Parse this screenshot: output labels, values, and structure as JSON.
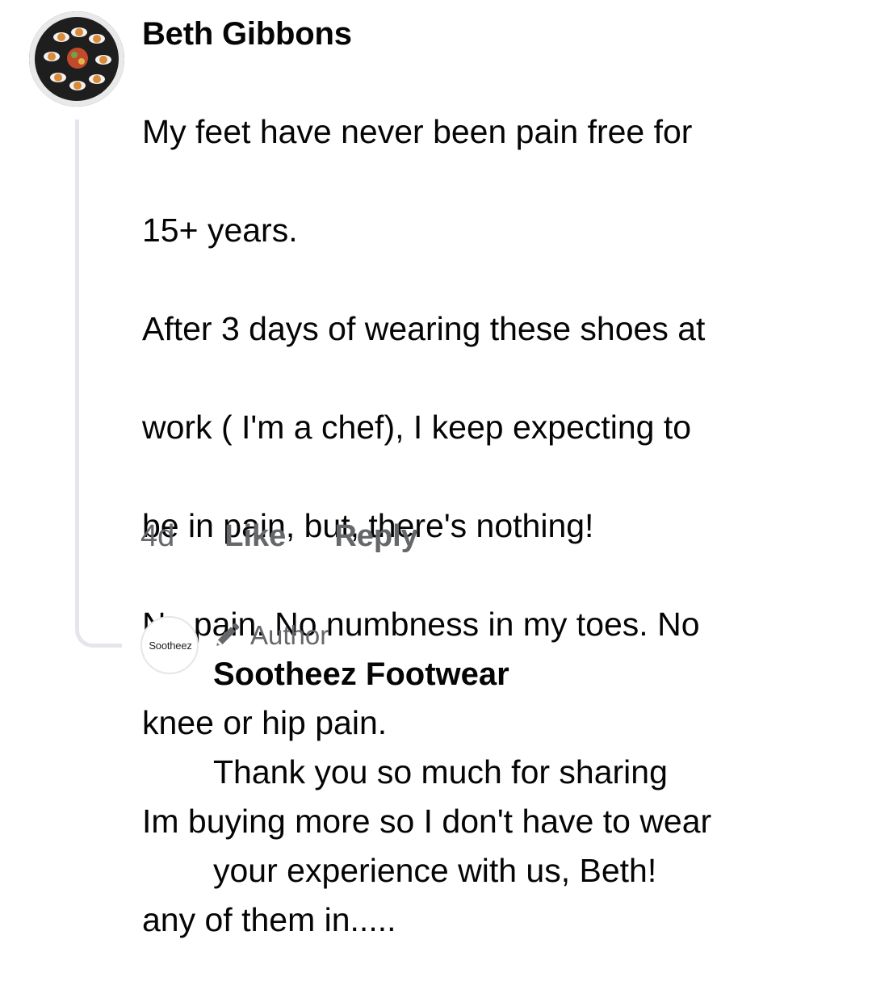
{
  "comment": {
    "author": "Beth Gibbons",
    "lines": [
      "My feet have never been pain free for",
      "15+ years.",
      "After 3 days of wearing these shoes at",
      "work ( I'm a chef), I keep expecting to",
      "be in pain, but, there's nothing!",
      "No pain. No numbness in my toes. No",
      "knee or hip pain.",
      "Im buying more so I don't have to wear",
      "any of them in....."
    ],
    "time": "4d",
    "like_label": "Like",
    "reply_label": "Reply"
  },
  "reply": {
    "avatar_text": "Sootheez",
    "badge_label": "Author",
    "badge_icon": "pencil-icon",
    "author": "Sootheez Footwear",
    "lines": [
      "Thank you so much for sharing",
      "your experience with us, Beth!"
    ]
  },
  "colors": {
    "text": "#050505",
    "secondary": "#65676b",
    "thread_line": "#e4e6eb"
  }
}
